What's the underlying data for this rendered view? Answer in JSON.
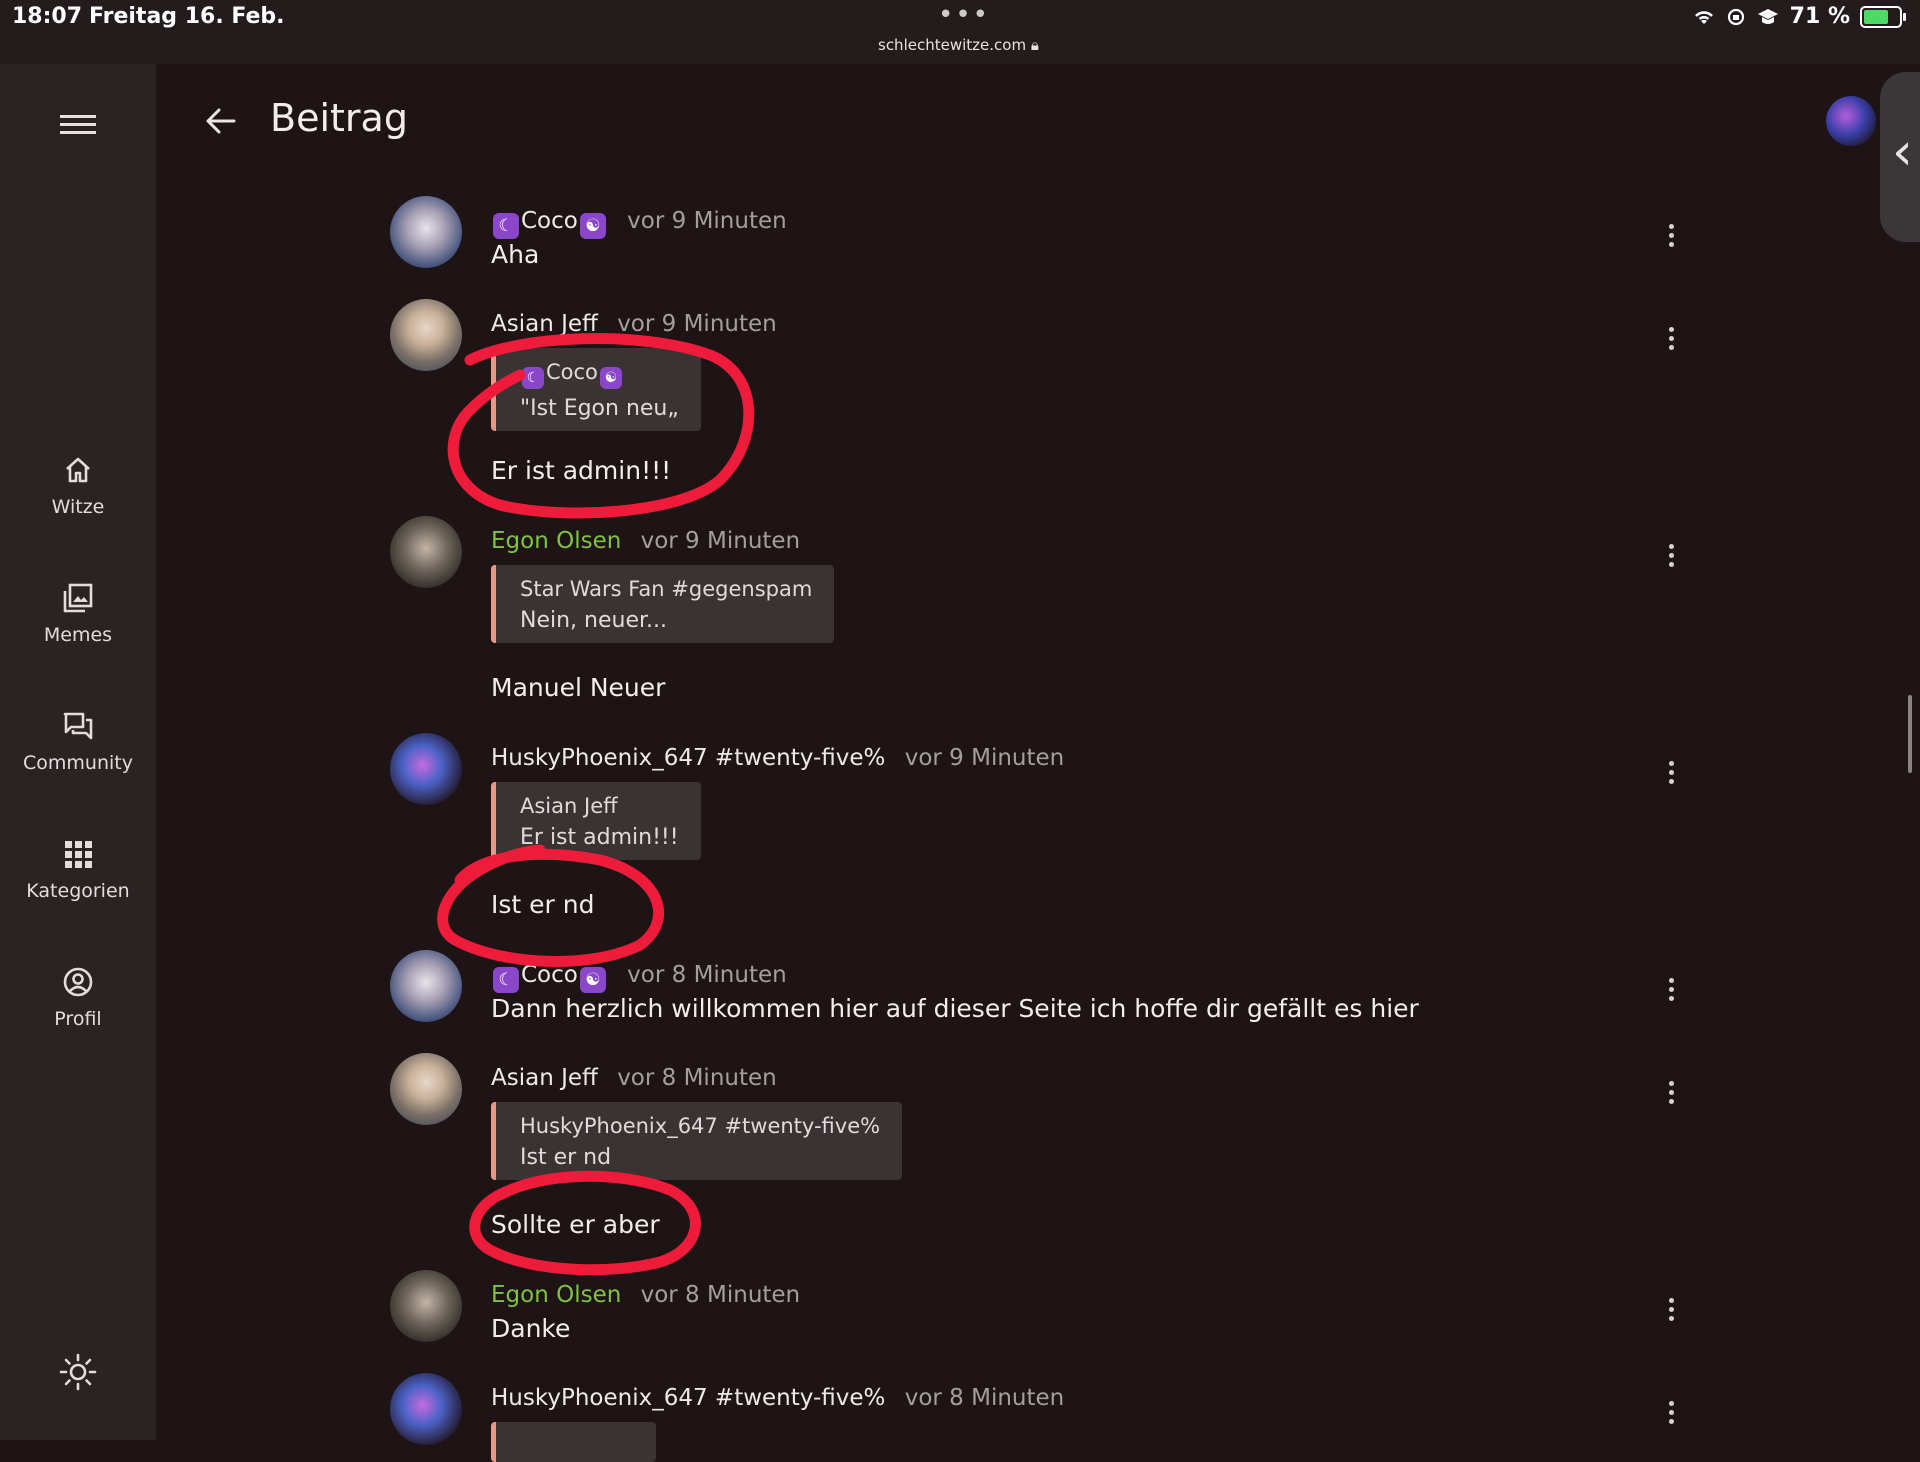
{
  "status_bar": {
    "time": "18:07",
    "date": "Freitag 16. Feb.",
    "url": "schlechtewitze.com",
    "battery": "71 %",
    "battery_level_percent": 71
  },
  "sidebar": {
    "items": [
      {
        "label": "Witze",
        "icon": "home-icon"
      },
      {
        "label": "Memes",
        "icon": "image-gallery-icon"
      },
      {
        "label": "Community",
        "icon": "chat-bubbles-icon"
      },
      {
        "label": "Kategorien",
        "icon": "grid-icon"
      },
      {
        "label": "Profil",
        "icon": "user-circle-icon"
      }
    ]
  },
  "header": {
    "title": "Beitrag"
  },
  "posts": [
    {
      "author": "Coco",
      "time": "vor 9 Minuten",
      "text": "Aha"
    },
    {
      "author": "Asian Jeff",
      "time": "vor 9 Minuten",
      "quote_author": "Coco",
      "quote_text": "\"Ist Egon neu„",
      "text": "Er ist admin!!!"
    },
    {
      "author": "Egon Olsen",
      "time": "vor 9 Minuten",
      "quote_author": "Star Wars Fan #gegenspam",
      "quote_text": "Nein, neuer...",
      "text": "Manuel Neuer"
    },
    {
      "author": "HuskyPhoenix_647 #twenty-five%",
      "time": "vor 9 Minuten",
      "quote_author": "Asian Jeff",
      "quote_text": "Er ist admin!!!",
      "text": "Ist er nd"
    },
    {
      "author": "Coco",
      "time": "vor 8 Minuten",
      "text": "Dann herzlich willkommen hier auf dieser Seite ich hoffe dir gefällt es hier"
    },
    {
      "author": "Asian Jeff",
      "time": "vor 8 Minuten",
      "quote_author": "HuskyPhoenix_647 #twenty-five%",
      "quote_text": "Ist er nd",
      "text": "Sollte er aber"
    },
    {
      "author": "Egon Olsen",
      "time": "vor 8 Minuten",
      "text": "Danke"
    },
    {
      "author": "HuskyPhoenix_647 #twenty-five%",
      "time": "vor 8 Minuten"
    }
  ],
  "colors": {
    "background": "#1e1415",
    "sidebar": "#2a2223",
    "quote_accent": "#e59a86",
    "admin_name": "#7fc33f",
    "annotation": "#ee1c3a",
    "coco_badge": "#8a47c9"
  }
}
